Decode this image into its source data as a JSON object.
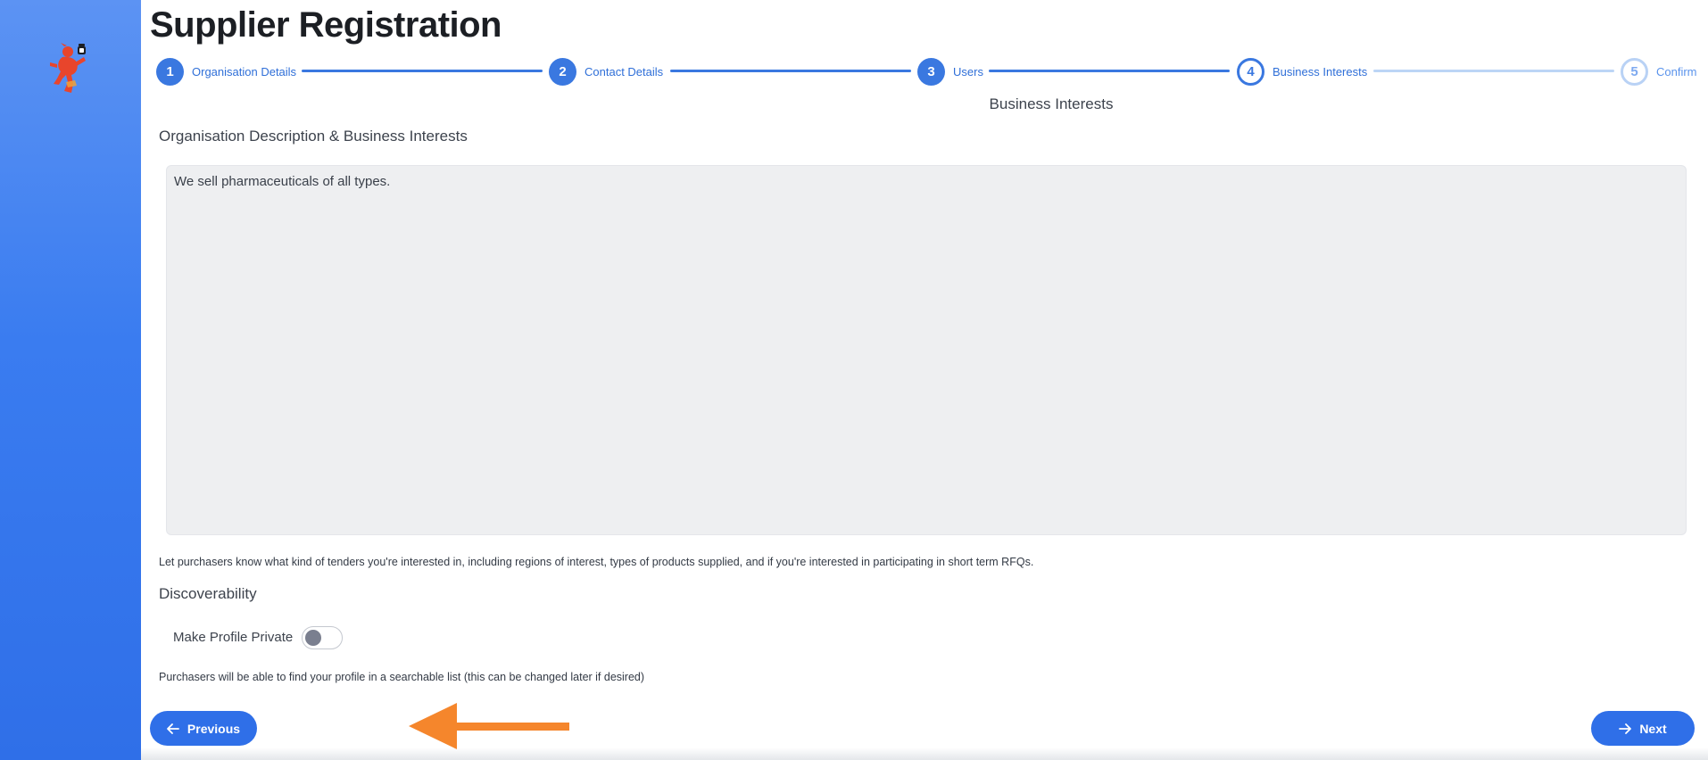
{
  "app": {
    "logo_icon": "mascot-logo-icon",
    "title": "Supplier Registration"
  },
  "stepper": {
    "steps": [
      {
        "number": "1",
        "label": "Organisation Details",
        "state": "complete"
      },
      {
        "number": "2",
        "label": "Contact Details",
        "state": "complete"
      },
      {
        "number": "3",
        "label": "Users",
        "state": "complete"
      },
      {
        "number": "4",
        "label": "Business Interests",
        "state": "current"
      },
      {
        "number": "5",
        "label": "Confirm",
        "state": "upcoming"
      }
    ]
  },
  "form": {
    "section_title": "Business Interests",
    "description_title": "Organisation Description & Business Interests",
    "description_value": "We sell pharmaceuticals of all types.",
    "description_help": "Let purchasers know what kind of tenders you're interested in, including regions of interest, types of products supplied, and if you're interested in participating in short term RFQs.",
    "discoverability_title": "Discoverability",
    "private_toggle_label": "Make Profile Private",
    "private_toggle_on": false,
    "discoverability_help": "Purchasers will be able to find your profile in a searchable list (this can be changed later if desired)"
  },
  "footer": {
    "previous_label": "Previous",
    "previous_icon": "arrow-left-icon",
    "next_label": "Next",
    "next_icon": "arrow-right-icon"
  },
  "annotation": {
    "arrow_icon": "pointer-arrow-icon",
    "arrow_color": "#f5862c"
  },
  "colors": {
    "accent": "#2f6fe8",
    "step_complete": "#3a78e0",
    "step_upcoming": "#bcd5f6"
  }
}
